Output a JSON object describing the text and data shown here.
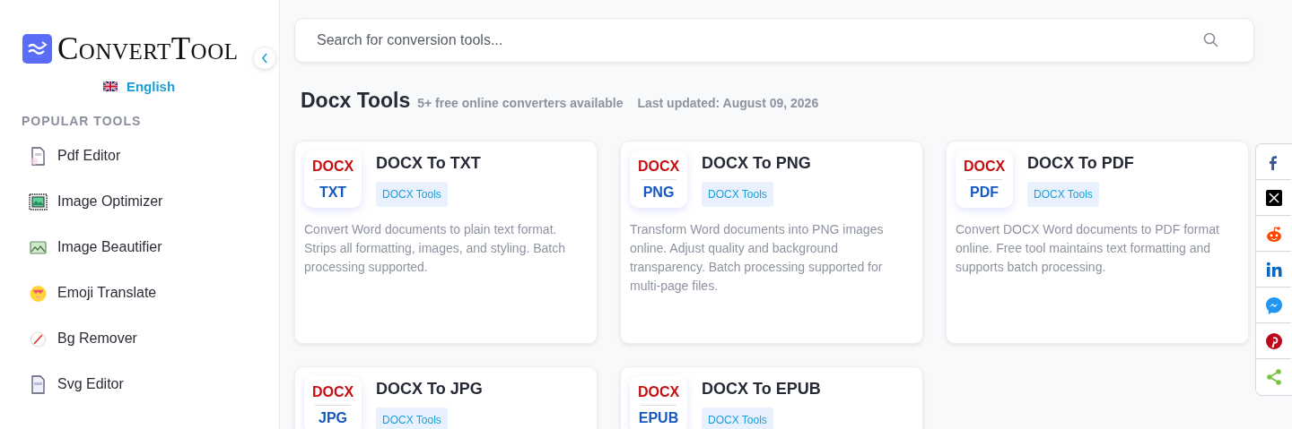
{
  "sidebar": {
    "brand": "ConvertTool",
    "language": "English",
    "section_title": "POPULAR TOOLS",
    "items": [
      {
        "label": "Pdf Editor",
        "kind": "pdf"
      },
      {
        "label": "Image Optimizer",
        "kind": "optimize"
      },
      {
        "label": "Image Beautifier",
        "kind": "image"
      },
      {
        "label": "Emoji Translate",
        "kind": "emoji"
      },
      {
        "label": "Bg Remover",
        "kind": "remove"
      },
      {
        "label": "Svg Editor",
        "kind": "svg"
      }
    ]
  },
  "search": {
    "placeholder": "Search for conversion tools..."
  },
  "header": {
    "title": "Docx Tools",
    "subtitle": "5+ free online converters available",
    "updated": "Last updated: August 09, 2026"
  },
  "cards": [
    {
      "from": "DOCX",
      "to": "TXT",
      "title": "DOCX To TXT",
      "tag": "DOCX Tools",
      "description": "Convert Word documents to plain text format. Strips all formatting, images, and styling. Batch processing supported."
    },
    {
      "from": "DOCX",
      "to": "PNG",
      "title": "DOCX To PNG",
      "tag": "DOCX Tools",
      "description": "Transform Word documents into PNG images online. Adjust quality and background transparency. Batch processing supported for multi-page files."
    },
    {
      "from": "DOCX",
      "to": "PDF",
      "title": "DOCX To PDF",
      "tag": "DOCX Tools",
      "description": "Convert DOCX Word documents to PDF format online. Free tool maintains text formatting and supports batch processing."
    },
    {
      "from": "DOCX",
      "to": "JPG",
      "title": "DOCX To JPG",
      "tag": "DOCX Tools"
    },
    {
      "from": "DOCX",
      "to": "EPUB",
      "title": "DOCX To EPUB",
      "tag": "DOCX Tools"
    }
  ],
  "share": [
    {
      "kind": "facebook"
    },
    {
      "kind": "x"
    },
    {
      "kind": "reddit"
    },
    {
      "kind": "linkedin"
    },
    {
      "kind": "messenger"
    },
    {
      "kind": "pinterest"
    },
    {
      "kind": "share"
    }
  ]
}
